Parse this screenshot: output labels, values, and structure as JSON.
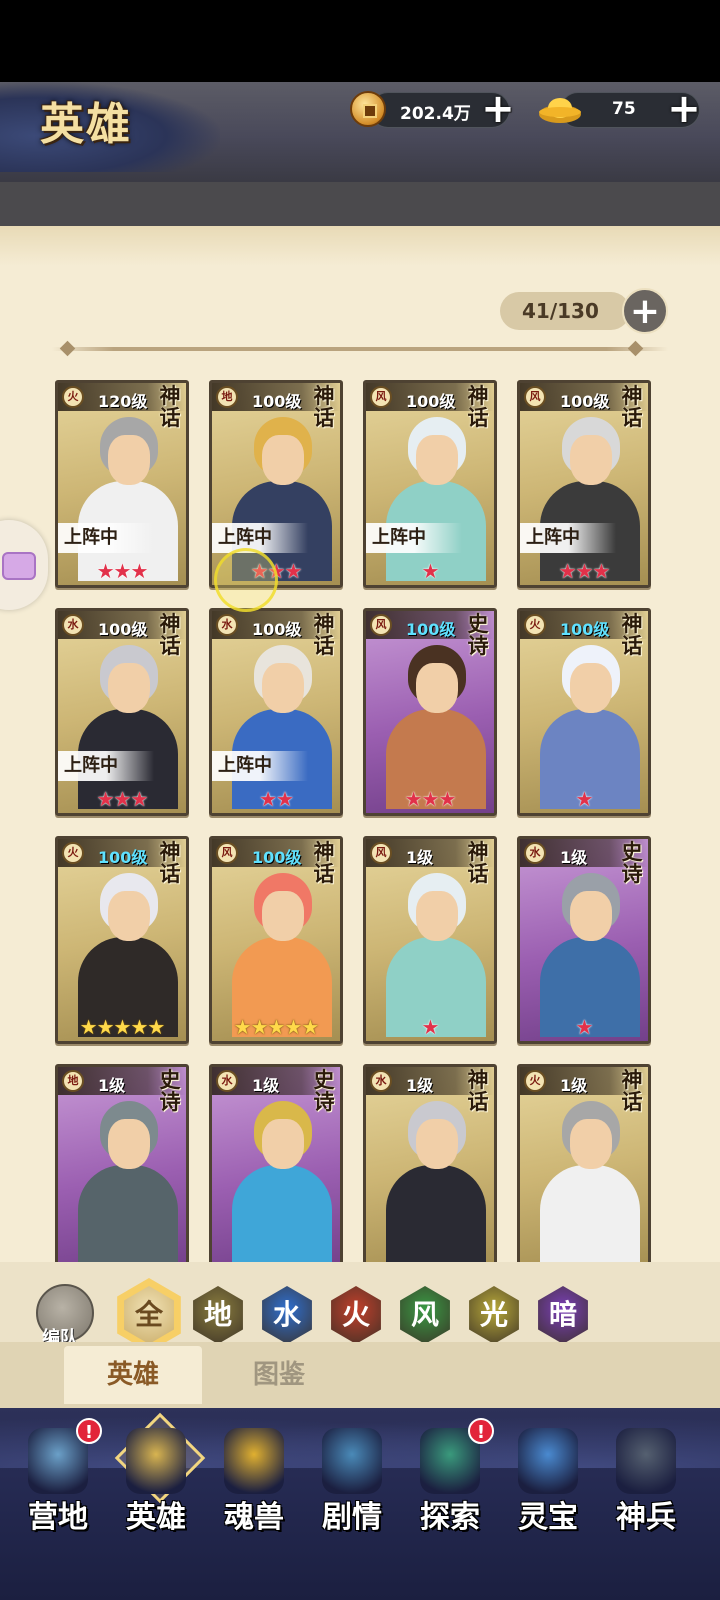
{
  "header": {
    "title": "英雄",
    "coins": "202.4万",
    "ingots": "75"
  },
  "roster": {
    "count": "41/130"
  },
  "deploy_label": "上阵中",
  "cards": [
    {
      "element": "火",
      "level": "120级",
      "rarity": "神话",
      "deployed": true,
      "stars": 3,
      "star_color": "red",
      "frame": "myth",
      "hair": "#a7a7a7",
      "body": "#f0f0f0"
    },
    {
      "element": "地",
      "level": "100级",
      "rarity": "神话",
      "deployed": true,
      "stars": 3,
      "star_color": "red",
      "frame": "myth",
      "hair": "#e0b24b",
      "body": "#344061"
    },
    {
      "element": "风",
      "level": "100级",
      "rarity": "神话",
      "deployed": true,
      "stars": 1,
      "star_color": "red",
      "frame": "myth",
      "hair": "#e6eef2",
      "body": "#8fd0c6"
    },
    {
      "element": "风",
      "level": "100级",
      "rarity": "神话",
      "deployed": true,
      "stars": 3,
      "star_color": "red",
      "frame": "myth",
      "hair": "#d8d8d8",
      "body": "#3b3b3b"
    },
    {
      "element": "水",
      "level": "100级",
      "rarity": "神话",
      "deployed": true,
      "stars": 3,
      "star_color": "red",
      "frame": "myth",
      "hair": "#c9c9cf",
      "body": "#2a2a33"
    },
    {
      "element": "水",
      "level": "100级",
      "rarity": "神话",
      "deployed": true,
      "stars": 2,
      "star_color": "red",
      "frame": "myth",
      "hair": "#e8e4dc",
      "body": "#3a6bc2"
    },
    {
      "element": "风",
      "level": "100级",
      "rarity": "史诗",
      "deployed": false,
      "stars": 3,
      "star_color": "red",
      "frame": "epic",
      "hair": "#4a3222",
      "body": "#c47a4e"
    },
    {
      "element": "火",
      "level": "100级",
      "rarity": "神话",
      "deployed": false,
      "stars": 1,
      "star_color": "red",
      "frame": "myth",
      "hair": "#eef2fa",
      "body": "#6c84c2"
    },
    {
      "element": "火",
      "level": "100级",
      "rarity": "神话",
      "deployed": false,
      "stars": 5,
      "star_color": "gold",
      "frame": "myth",
      "hair": "#e8e8ee",
      "body": "#2f2a28"
    },
    {
      "element": "风",
      "level": "100级",
      "rarity": "神话",
      "deployed": false,
      "stars": 5,
      "star_color": "gold",
      "frame": "myth",
      "hair": "#f07866",
      "body": "#f29a52"
    },
    {
      "element": "风",
      "level": "1级",
      "rarity": "神话",
      "deployed": false,
      "stars": 1,
      "star_color": "red",
      "frame": "myth",
      "hair": "#e6eef2",
      "body": "#8fd0c6"
    },
    {
      "element": "水",
      "level": "1级",
      "rarity": "史诗",
      "deployed": false,
      "stars": 1,
      "star_color": "red",
      "frame": "epic",
      "hair": "#9aa0a8",
      "body": "#3e6fa8"
    },
    {
      "element": "地",
      "level": "1级",
      "rarity": "史诗",
      "deployed": false,
      "stars": 0,
      "star_color": "red",
      "frame": "epic",
      "hair": "#7d8a8e",
      "body": "#56646a"
    },
    {
      "element": "水",
      "level": "1级",
      "rarity": "史诗",
      "deployed": false,
      "stars": 0,
      "star_color": "red",
      "frame": "epic",
      "hair": "#d9b84a",
      "body": "#3fa6d8"
    },
    {
      "element": "水",
      "level": "1级",
      "rarity": "神话",
      "deployed": false,
      "stars": 0,
      "star_color": "red",
      "frame": "myth",
      "hair": "#c9c9cf",
      "body": "#2a2a33"
    },
    {
      "element": "火",
      "level": "1级",
      "rarity": "神话",
      "deployed": false,
      "stars": 0,
      "star_color": "red",
      "frame": "myth",
      "hair": "#a7a7a7",
      "body": "#f0f0f0"
    }
  ],
  "filters": {
    "team_label": "编队",
    "items": [
      {
        "label": "全",
        "color": "#8b6a34",
        "selected": true
      },
      {
        "label": "地",
        "color": "#8a7d3e"
      },
      {
        "label": "水",
        "color": "#2f6fd0"
      },
      {
        "label": "火",
        "color": "#c2402c"
      },
      {
        "label": "风",
        "color": "#3a9a44"
      },
      {
        "label": "光",
        "color": "#b8a93a"
      },
      {
        "label": "暗",
        "color": "#7a3fb8"
      }
    ]
  },
  "tabs": {
    "heroes": "英雄",
    "codex": "图鉴"
  },
  "nav": [
    {
      "label": "营地",
      "alert": "!",
      "color": "#6ba0c8"
    },
    {
      "label": "英雄",
      "alert": "",
      "color": "#d8b450",
      "active": true
    },
    {
      "label": "魂兽",
      "alert": "",
      "color": "#e0b030"
    },
    {
      "label": "剧情",
      "alert": "",
      "color": "#4a8ab8"
    },
    {
      "label": "探索",
      "alert": "!",
      "color": "#3a9a7c"
    },
    {
      "label": "灵宝",
      "alert": "",
      "color": "#4a8ad0"
    },
    {
      "label": "神兵",
      "alert": "",
      "color": "#556070"
    }
  ]
}
